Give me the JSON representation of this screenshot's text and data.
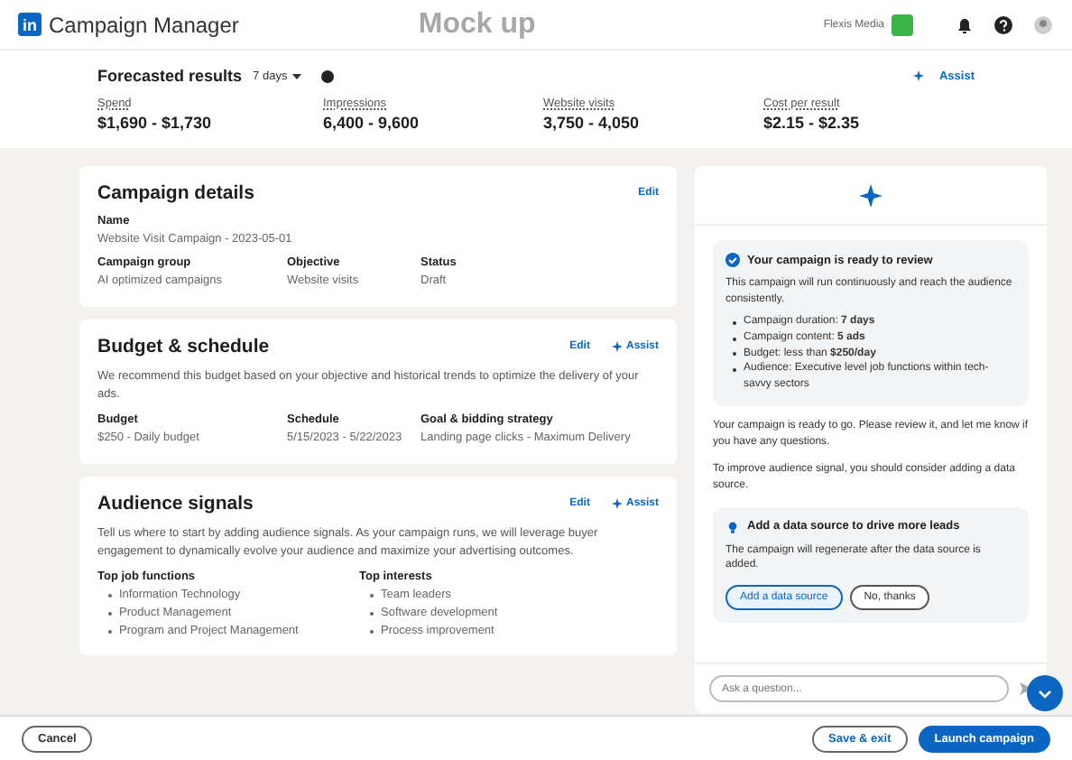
{
  "header": {
    "logo": "in",
    "title": "Campaign Manager",
    "mockup_label": "Mock up",
    "account": "Flexis Media"
  },
  "forecast": {
    "title": "Forecasted results",
    "period": "7 days",
    "assist": "Assist",
    "metrics": [
      {
        "label": "Spend",
        "value": "$1,690 - $1,730"
      },
      {
        "label": "Impressions",
        "value": "6,400 - 9,600"
      },
      {
        "label": "Website visits",
        "value": "3,750 - 4,050"
      },
      {
        "label": "Cost per result",
        "value": "$2.15 - $2.35"
      }
    ]
  },
  "cards": [
    {
      "title": "Campaign details",
      "edit": "Edit",
      "name_field": {
        "label": "Name",
        "value": "Website Visit Campaign - 2023-05-01"
      },
      "fields": [
        {
          "label": "Campaign group",
          "value": "AI optimized campaigns"
        },
        {
          "label": "Objective",
          "value": "Website visits"
        },
        {
          "label": "Status",
          "value": "Draft"
        }
      ]
    },
    {
      "title": "Budget & schedule",
      "edit": "Edit",
      "assist": "Assist",
      "description": "We recommend this budget based on your objective and historical trends to optimize the delivery of your ads.",
      "fields": [
        {
          "label": "Budget",
          "value": "$250 - Daily budget"
        },
        {
          "label": "Schedule",
          "value": "5/15/2023 - 5/22/2023"
        },
        {
          "label": "Goal & bidding strategy",
          "value": "Landing page clicks - Maximum Delivery"
        }
      ]
    },
    {
      "title": "Audience signals",
      "edit": "Edit",
      "assist": "Assist",
      "description": "Tell us where to start by adding audience signals. As your campaign runs, we will leverage buyer engagement to dynamically evolve your audience and maximize your advertising outcomes.",
      "lists": [
        {
          "label": "Top job functions",
          "items": [
            "Information Technology",
            "Product Management",
            "Program and Project Management"
          ]
        },
        {
          "label": "Top interests",
          "items": [
            "Team leaders",
            "Software development",
            "Process improvement"
          ]
        }
      ]
    }
  ],
  "assistant": {
    "review": {
      "title": "Your campaign is ready to review",
      "text": "This campaign will run continuously and reach the audience consistently.",
      "bullets": [
        "Campaign duration: **7 days**",
        "Campaign content: **5 ads**",
        "Budget: less than **$250/day**",
        "Audience: Executive level job functions within tech-savvy sectors"
      ]
    },
    "messages": [
      "Your campaign is ready to go. Please review it, and let me know if you have any questions.",
      "To improve audience signal, you should consider adding a data source."
    ],
    "suggestion": {
      "title": "Add a data source to drive more leads",
      "text": "The campaign will regenerate after the data source is added.",
      "primary": "Add a data source",
      "secondary": "No, thanks"
    },
    "input": {
      "placeholder": "Ask a question..."
    }
  },
  "footer": {
    "cancel": "Cancel",
    "save": "Save & exit",
    "launch": "Launch campaign"
  }
}
